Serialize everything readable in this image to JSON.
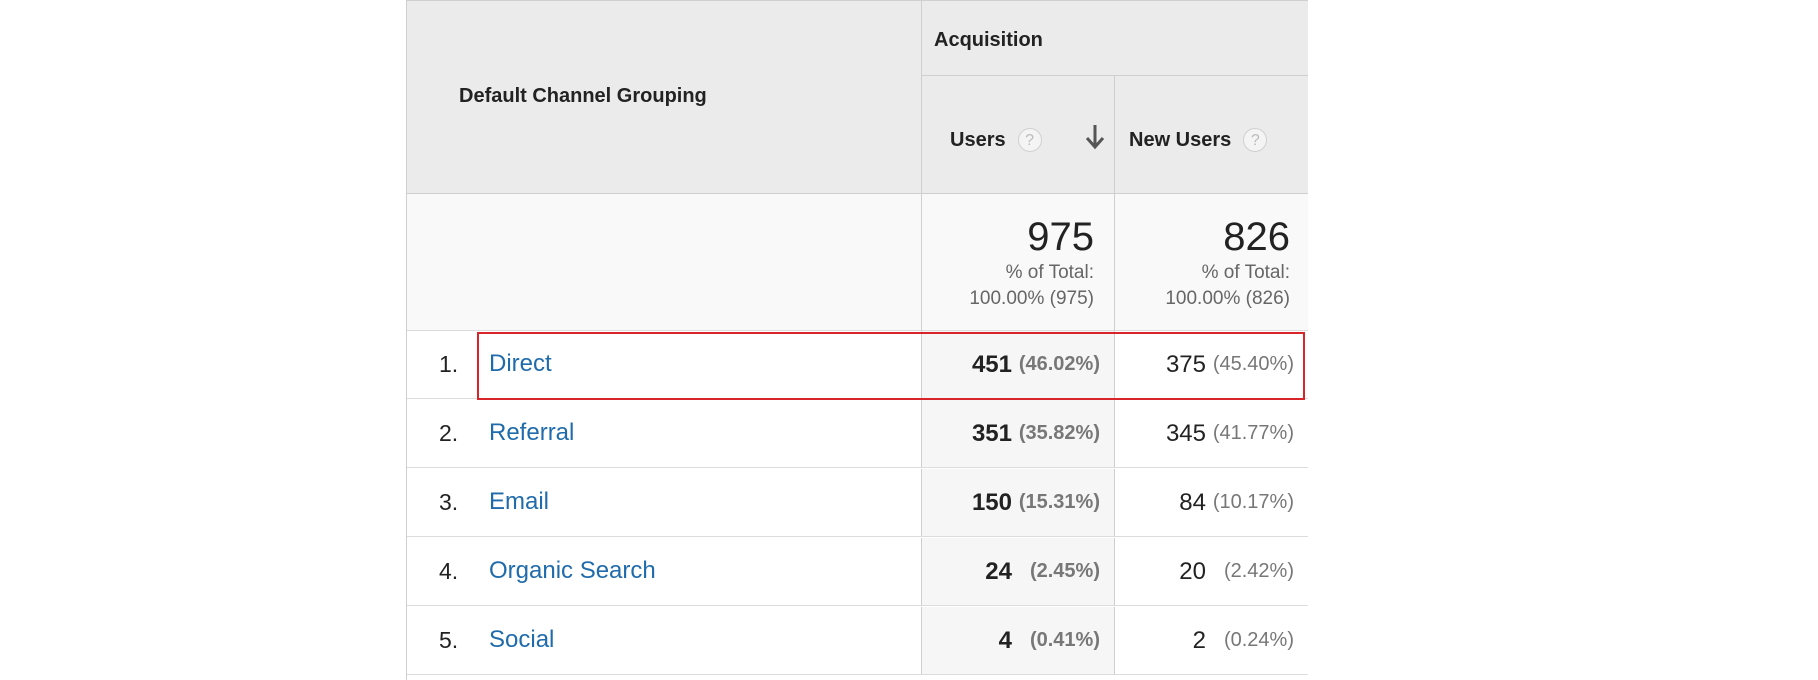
{
  "table": {
    "dimension_header": "Default Channel Grouping",
    "group_header": "Acquisition",
    "columns": [
      {
        "label": "Users",
        "help": "?"
      },
      {
        "label": "New Users",
        "help": "?"
      }
    ],
    "totals": {
      "users": {
        "value": "975",
        "line1": "% of Total:",
        "line2": "100.00% (975)"
      },
      "new_users": {
        "value": "826",
        "line1": "% of Total:",
        "line2": "100.00% (826)"
      }
    },
    "rows": [
      {
        "num": "1.",
        "channel": "Direct",
        "users": "451",
        "users_pct": "(46.02%)",
        "new_users": "375",
        "new_users_pct": "(45.40%)"
      },
      {
        "num": "2.",
        "channel": "Referral",
        "users": "351",
        "users_pct": "(35.82%)",
        "new_users": "345",
        "new_users_pct": "(41.77%)"
      },
      {
        "num": "3.",
        "channel": "Email",
        "users": "150",
        "users_pct": "(15.31%)",
        "new_users": "84",
        "new_users_pct": "(10.17%)"
      },
      {
        "num": "4.",
        "channel": "Organic Search",
        "users": "24",
        "users_pct": "(2.45%)",
        "new_users": "20",
        "new_users_pct": "(2.42%)"
      },
      {
        "num": "5.",
        "channel": "Social",
        "users": "4",
        "users_pct": "(0.41%)",
        "new_users": "2",
        "new_users_pct": "(0.24%)"
      }
    ]
  },
  "colors": {
    "link": "#1f6bab",
    "highlight": "#d9252a",
    "header_bg": "#ebebeb"
  },
  "icons": {
    "sort": "arrow-down-icon",
    "help": "help-circle-icon"
  }
}
